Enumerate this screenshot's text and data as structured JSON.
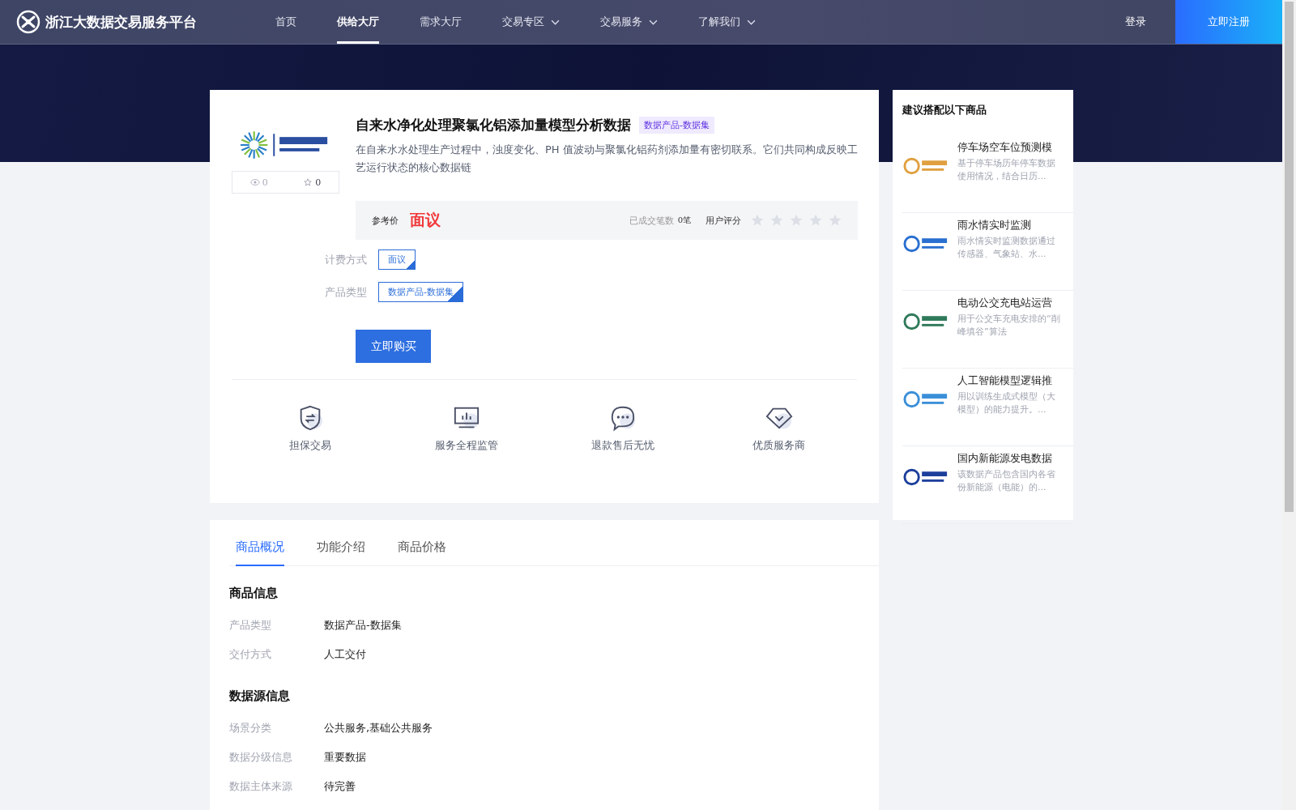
{
  "header": {
    "brand": "浙江大数据交易服务平台",
    "nav": [
      {
        "label": "首页",
        "selected": false,
        "dropdown": false
      },
      {
        "label": "供给大厅",
        "selected": true,
        "dropdown": false
      },
      {
        "label": "需求大厅",
        "selected": false,
        "dropdown": false
      },
      {
        "label": "交易专区",
        "selected": false,
        "dropdown": true
      },
      {
        "label": "交易服务",
        "selected": false,
        "dropdown": true
      },
      {
        "label": "了解我们",
        "selected": false,
        "dropdown": true
      }
    ],
    "login": "登录",
    "register": "立即注册"
  },
  "product": {
    "views": "0",
    "favorites": "0",
    "title": "自来水净化处理聚氯化铝添加量模型分析数据",
    "tag": "数据产品-数据集",
    "description": "在自来水水处理生产过程中，浊度变化、PH 值波动与聚氯化铝药剂添加量有密切联系。它们共同构成反映工艺运行状态的核心数据链",
    "price_label": "参考价",
    "price": "面议",
    "deals_label": "已成交笔数",
    "deals": "0笔",
    "rating_label": "用户评分",
    "stars": 0,
    "attributes": [
      {
        "label": "计费方式",
        "value": "面议"
      },
      {
        "label": "产品类型",
        "value": "数据产品-数据集"
      }
    ],
    "buy_button": "立即购买",
    "guarantees": [
      {
        "kind": "shield",
        "label": "担保交易"
      },
      {
        "kind": "monitor",
        "label": "服务全程监管"
      },
      {
        "kind": "chat",
        "label": "退款售后无忧"
      },
      {
        "kind": "diamond",
        "label": "优质服务商"
      }
    ]
  },
  "tabs": [
    {
      "label": "商品概况",
      "selected": true
    },
    {
      "label": "功能介绍",
      "selected": false
    },
    {
      "label": "商品价格",
      "selected": false
    }
  ],
  "sections": [
    {
      "title": "商品信息",
      "rows": [
        {
          "label": "产品类型",
          "value": "数据产品-数据集"
        },
        {
          "label": "交付方式",
          "value": "人工交付"
        }
      ]
    },
    {
      "title": "数据源信息",
      "rows": [
        {
          "label": "场景分类",
          "value": "公共服务,基础公共服务"
        },
        {
          "label": "数据分级信息",
          "value": "重要数据"
        },
        {
          "label": "数据主体来源",
          "value": "待完善"
        }
      ]
    }
  ],
  "suggestions": {
    "title": "建议搭配以下商品",
    "items": [
      {
        "title": "停车场空车位预测模",
        "description": "基于停车场历年停车数据使用情况，结合日历...",
        "color": "#e0a040"
      },
      {
        "title": "雨水情实时监测",
        "description": "雨水情实时监测数据通过传感器、气象站、水...",
        "color": "#2a6fd0"
      },
      {
        "title": "电动公交充电站运营",
        "description": "用于公交车充电安排的“削峰填谷”算法",
        "color": "#2f7a5a"
      },
      {
        "title": "人工智能模型逻辑推",
        "description": "用以训练生成式模型（大模型）的能力提升。...",
        "color": "#3a8fd8"
      },
      {
        "title": "国内新能源发电数据",
        "description": "该数据产品包含国内各省份新能源（电能）的...",
        "color": "#1d3f9c"
      }
    ]
  }
}
